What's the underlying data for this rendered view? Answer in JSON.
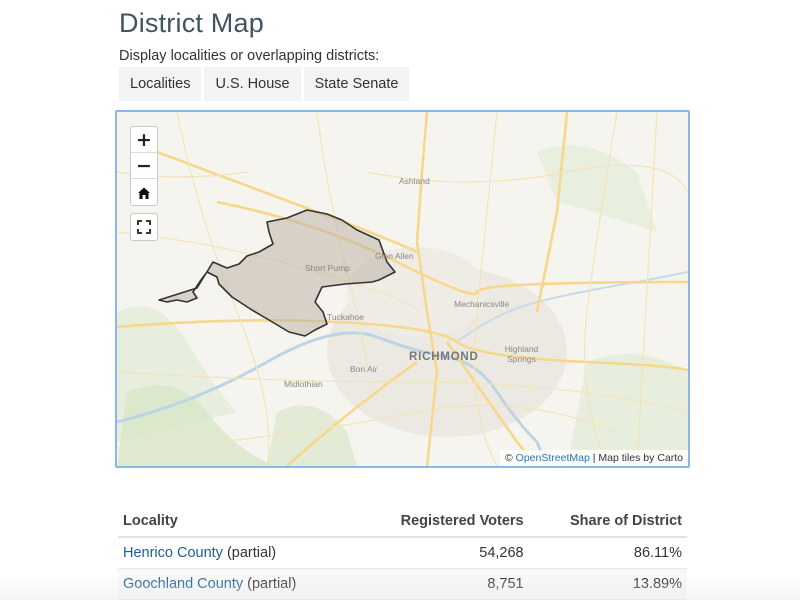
{
  "header": {
    "title": "District Map",
    "subtitle": "Display localities or overlapping districts:"
  },
  "layer_buttons": [
    {
      "label": "Localities"
    },
    {
      "label": "U.S. House"
    },
    {
      "label": "State Senate"
    }
  ],
  "map": {
    "controls": {
      "zoom_in": "+",
      "zoom_out": "−"
    },
    "place_labels": {
      "ashland": "Ashland",
      "glen_allen": "Glen Allen",
      "short_pump": "Short Pump",
      "mechanicsville": "Mechanicsville",
      "tuckahoe": "Tuckahoe",
      "richmond": "RICHMOND",
      "highland_springs": "Highland Springs",
      "bon_air": "Bon Air",
      "midlothian": "Midlothian"
    },
    "attribution": {
      "copyright": "©",
      "osm": "OpenStreetMap",
      "tiles": " | Map tiles by Carto"
    },
    "colors": {
      "district_fill": "#bdb5a8",
      "district_stroke": "#333333",
      "roads": "#f7d88a",
      "frame_border": "#8bb6ea"
    }
  },
  "table": {
    "headers": [
      "Locality",
      "Registered Voters",
      "Share of District"
    ],
    "rows": [
      {
        "locality": "Henrico County",
        "note": " (partial)",
        "voters": "54,268",
        "share": "86.11%"
      },
      {
        "locality": "Goochland County",
        "note": " (partial)",
        "voters": "8,751",
        "share": "13.89%"
      }
    ]
  }
}
